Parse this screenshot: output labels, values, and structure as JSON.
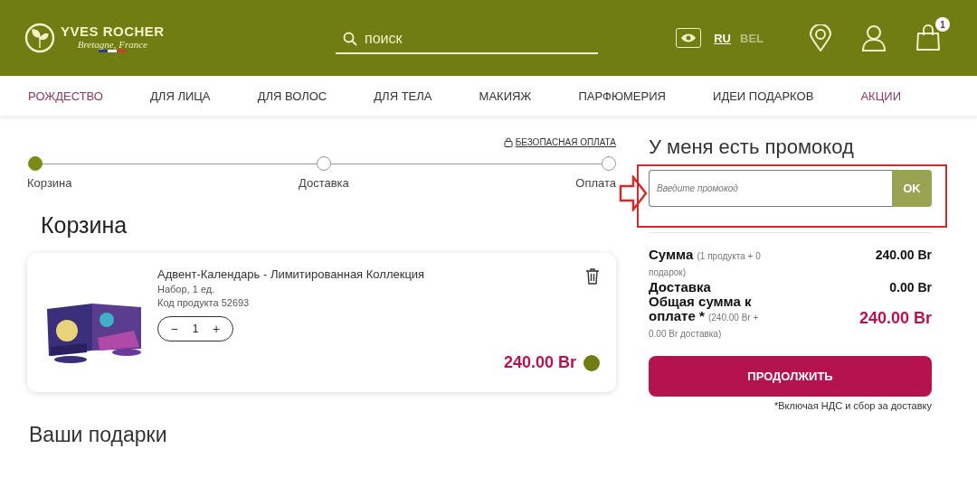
{
  "header": {
    "logo": {
      "brand": "YVES ROCHER",
      "tagline": "Bretagne, France"
    },
    "search": {
      "placeholder": "поиск"
    },
    "languages": [
      {
        "label": "RU",
        "selected": true
      },
      {
        "label": "BEL",
        "selected": false
      }
    ],
    "cart_count": "1"
  },
  "nav": [
    {
      "label": "РОЖДЕСТВО",
      "highlighted": true
    },
    {
      "label": "ДЛЯ ЛИЦА",
      "highlighted": false
    },
    {
      "label": "ДЛЯ ВОЛОС",
      "highlighted": false
    },
    {
      "label": "ДЛЯ ТЕЛА",
      "highlighted": false
    },
    {
      "label": "МАКИЯЖ",
      "highlighted": false
    },
    {
      "label": "ПАРФЮМЕРИЯ",
      "highlighted": false
    },
    {
      "label": "ИДЕИ ПОДАРКОВ",
      "highlighted": false
    },
    {
      "label": "АКЦИИ",
      "highlighted": true
    }
  ],
  "secure_payment": "БЕЗОПАСНАЯ ОПЛАТА",
  "steps": [
    {
      "label": "Корзина",
      "selected": true
    },
    {
      "label": "Доставка",
      "selected": false
    },
    {
      "label": "Оплата",
      "selected": false
    }
  ],
  "cart": {
    "title": "Корзина",
    "items": [
      {
        "name": "Адвент-Календарь - Лимитированная Коллекция",
        "detail": "Набор, 1 ед.",
        "code": "Код продукта 52693",
        "quantity": "1",
        "minus": "−",
        "plus": "+",
        "price": "240.00 Br",
        "color": "#6f7d12"
      }
    ]
  },
  "gifts_title": "Ваши подарки",
  "promo": {
    "title": "У меня есть промокод",
    "placeholder": "Введите промокод",
    "button": "OK"
  },
  "summary": [
    {
      "kind": "normal",
      "label": "Сумма",
      "note": "(1 продукта + 0 подарок)",
      "value": "240.00 Br"
    },
    {
      "kind": "normal",
      "label": "Доставка",
      "value": "0.00 Br"
    },
    {
      "kind": "total",
      "label": "Общая сумма к оплате *",
      "note": "(240.00 Br + 0.00 Br доставка)",
      "value": "240.00 Br"
    }
  ],
  "continue_button": "ПРОДОЛЖИТЬ",
  "vat_note": "*Включая НДС и сбор за доставку"
}
